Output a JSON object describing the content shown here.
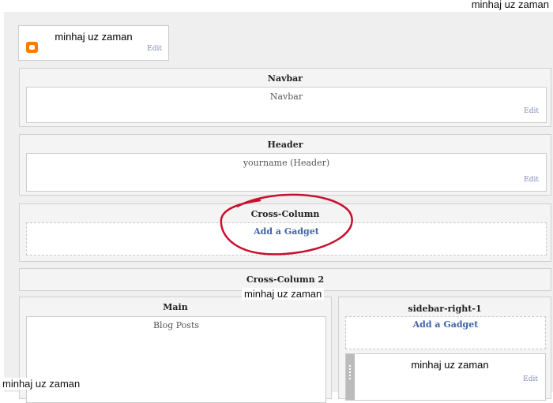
{
  "watermark": "minhaj uz zaman",
  "profile_gadget": {
    "title": "minhaj uz zaman",
    "edit": "Edit"
  },
  "navbar": {
    "title": "Navbar",
    "gadget": "Navbar",
    "edit": "Edit"
  },
  "header": {
    "title": "Header",
    "gadget": "yourname (Header)",
    "edit": "Edit"
  },
  "cross_column": {
    "title": "Cross-Column",
    "add": "Add a Gadget"
  },
  "cross_column_2": {
    "title": "Cross-Column 2"
  },
  "main": {
    "title": "Main",
    "gadget": "Blog Posts"
  },
  "sidebar": {
    "title": "sidebar-right-1",
    "add": "Add a Gadget",
    "gadget": "minhaj uz zaman",
    "edit": "Edit"
  },
  "colors": {
    "annotation": "#c8102e",
    "blogger": "#f57d00"
  }
}
